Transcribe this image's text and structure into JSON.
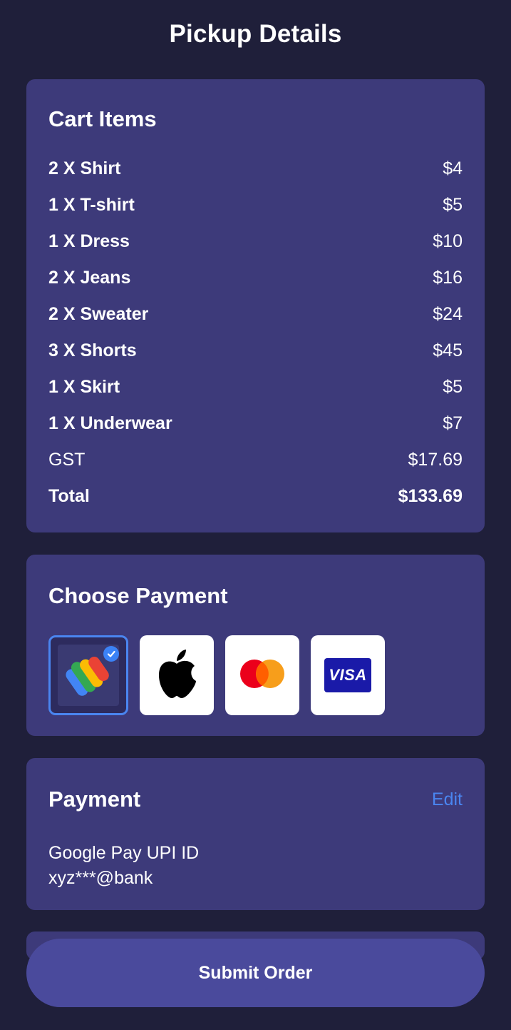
{
  "page": {
    "title": "Pickup Details"
  },
  "cart": {
    "title": "Cart Items",
    "items": [
      {
        "label": "2 X Shirt",
        "price": "$4"
      },
      {
        "label": "1 X T-shirt",
        "price": "$5"
      },
      {
        "label": "1 X Dress",
        "price": "$10"
      },
      {
        "label": "2 X Jeans",
        "price": "$16"
      },
      {
        "label": "2 X Sweater",
        "price": "$24"
      },
      {
        "label": "3 X Shorts",
        "price": "$45"
      },
      {
        "label": "1 X Skirt",
        "price": "$5"
      },
      {
        "label": "1 X Underwear",
        "price": "$7"
      }
    ],
    "gst": {
      "label": "GST",
      "value": "$17.69"
    },
    "total": {
      "label": "Total",
      "value": "$133.69"
    }
  },
  "choose_payment": {
    "title": "Choose Payment",
    "methods": [
      {
        "icon": "google-pay-icon",
        "selected": true
      },
      {
        "icon": "apple-icon",
        "selected": false
      },
      {
        "icon": "mastercard-icon",
        "selected": false
      },
      {
        "icon": "visa-icon",
        "label": "VISA",
        "selected": false
      }
    ]
  },
  "payment": {
    "title": "Payment",
    "edit_label": "Edit",
    "method_name": "Google Pay UPI ID",
    "account": "xyz***@bank"
  },
  "submit": {
    "label": "Submit Order"
  },
  "colors": {
    "background": "#1f1f3a",
    "card": "#3d3a7a",
    "accent": "#4a85f0",
    "button": "#4a4a9c"
  }
}
